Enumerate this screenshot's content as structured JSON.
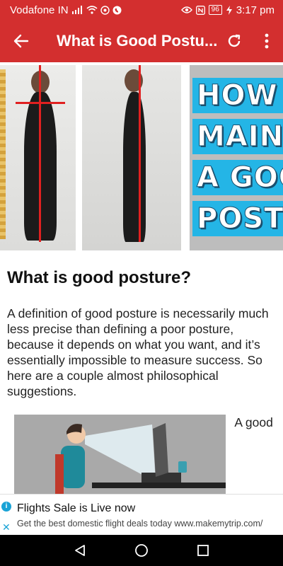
{
  "status_bar": {
    "carrier": "Vodafone IN",
    "battery": "96",
    "time": "3:17 pm"
  },
  "app_bar": {
    "title": "What is Good Postu..."
  },
  "hero": {
    "banner_lines": [
      "HOW T",
      "MAINTAI",
      "A GOO",
      "POSTUR"
    ]
  },
  "article": {
    "heading": "What is good posture?",
    "paragraph": "A definition of good posture is necessarily much less precise than defining a poor posture, because it depends on what you want, and it’s essentially impossible to measure success. So here are a couple almost philosophical suggestions.",
    "figure_caption_start": "A good"
  },
  "ad": {
    "title": "Flights Sale is Live now",
    "subtitle": "Get the best domestic flight deals today www.makemytrip.com/"
  },
  "colors": {
    "app_bar": "#d32f2f",
    "banner": "#24b5e6",
    "posture_line": "#e02020"
  }
}
